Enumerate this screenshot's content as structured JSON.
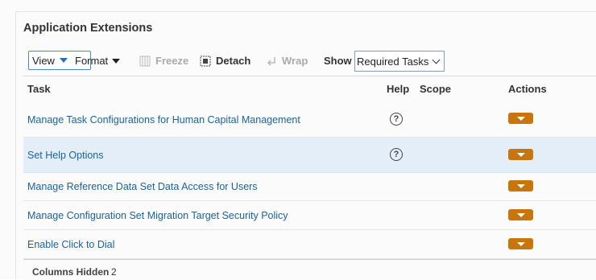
{
  "panel": {
    "title": "Application Extensions"
  },
  "toolbar": {
    "view_label": "View",
    "format_label": "Format",
    "freeze_label": "Freeze",
    "detach_label": "Detach",
    "wrap_label": "Wrap",
    "show_label": "Show",
    "show_selected": "Required Tasks"
  },
  "table": {
    "columns": [
      "Task",
      "Help",
      "Scope",
      "Actions"
    ],
    "rows": [
      {
        "task": "Manage Task Configurations for Human Capital Management",
        "help": true
      },
      {
        "task": "Set Help Options",
        "help": true,
        "selected": true
      },
      {
        "task": "Manage Reference Data Set Data Access for Users",
        "help": false
      },
      {
        "task": "Manage Configuration Set Migration Target Security Policy",
        "help": false
      },
      {
        "task": "Enable Click to Dial",
        "help": false
      }
    ],
    "help_glyph": "?"
  },
  "footer": {
    "columns_hidden_label": "Columns Hidden",
    "columns_hidden_value": "2"
  },
  "colors": {
    "link": "#1a63a6",
    "action": "#c9750e",
    "selected_row": "#e4eef8"
  },
  "icons": [
    "chevron-down-icon",
    "freeze-icon",
    "detach-icon",
    "wrap-icon",
    "help-icon",
    "action-menu-icon"
  ]
}
